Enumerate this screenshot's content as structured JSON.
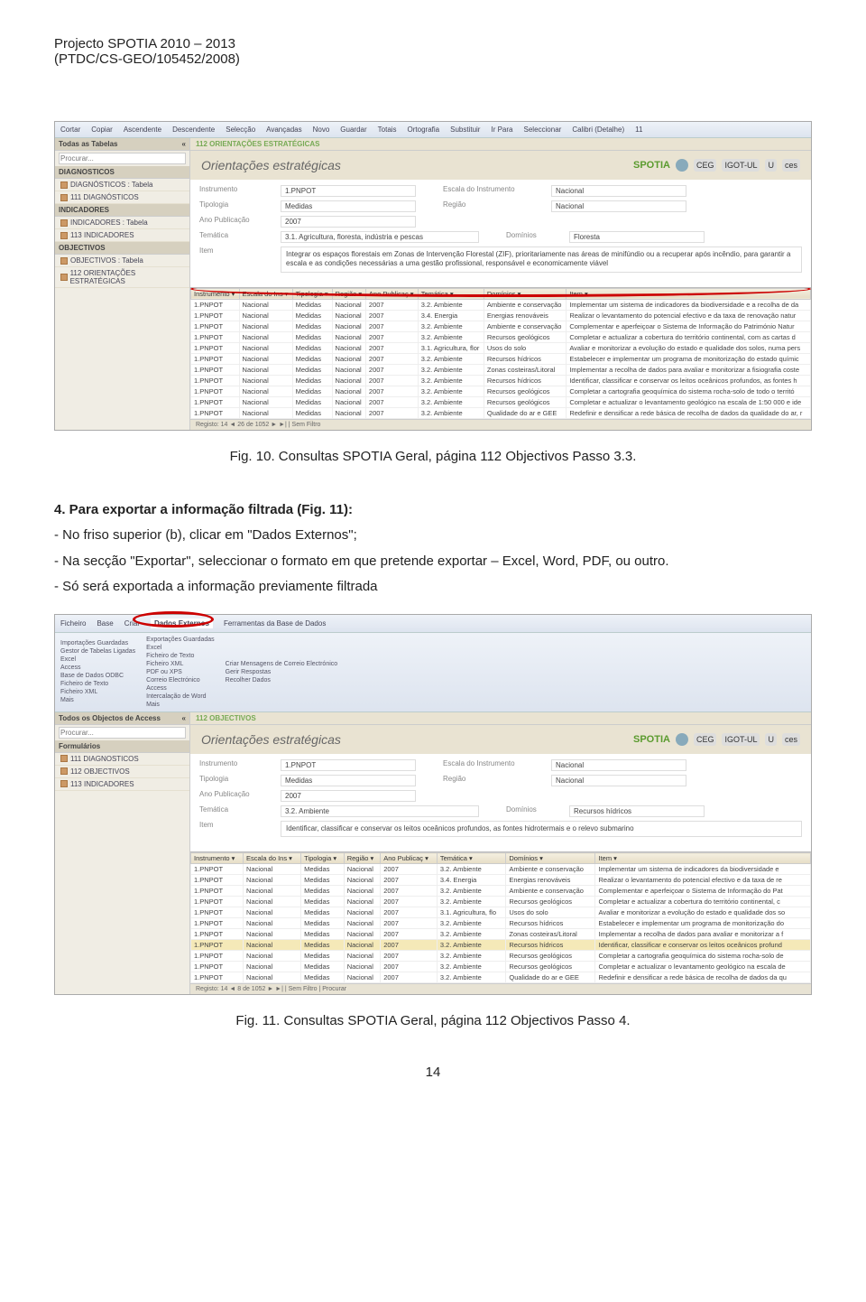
{
  "header": {
    "line1": "Projecto SPOTIA 2010 – 2013",
    "line2": "(PTDC/CS-GEO/105452/2008)"
  },
  "fig10": {
    "caption": "Fig. 10. Consultas SPOTIA Geral, página 112 Objectivos Passo 3.3.",
    "ribbon": [
      "Cortar",
      "Copiar",
      "Ascendente",
      "Descendente",
      "Selecção",
      "Avançadas",
      "Novo",
      "Guardar",
      "Totais",
      "Ortografia",
      "Substituir",
      "Ir Para",
      "Seleccionar",
      "Calibri (Detalhe)",
      "11"
    ],
    "sidebar": {
      "topLabel": "Todas as Tabelas",
      "searchPlaceholder": "Procurar...",
      "groups": [
        {
          "hdr": "DIAGNOSTICOS",
          "items": [
            "DIAGNÓSTICOS : Tabela",
            "111 DIAGNÓSTICOS"
          ]
        },
        {
          "hdr": "INDICADORES",
          "items": [
            "INDICADORES : Tabela",
            "113 INDICADORES"
          ]
        },
        {
          "hdr": "OBJECTIVOS",
          "items": [
            "OBJECTIVOS : Tabela",
            "112 ORIENTAÇÕES ESTRATÉGICAS"
          ]
        }
      ]
    },
    "tabLabel": "112 ORIENTAÇÕES ESTRATÉGICAS",
    "formTitle": "Orientações estratégicas",
    "logos": {
      "brand": "SPOTIA",
      "c1": "CEG",
      "c2": "IGOT-UL",
      "c3": "U",
      "c4": "ces"
    },
    "fields": {
      "instrumento": {
        "lbl": "Instrumento",
        "val": "1.PNPOT"
      },
      "escala": {
        "lbl": "Escala do Instrumento",
        "val": "Nacional"
      },
      "tipologia": {
        "lbl": "Tipologia",
        "val": "Medidas"
      },
      "regiao": {
        "lbl": "Região",
        "val": "Nacional"
      },
      "ano": {
        "lbl": "Ano Publicação",
        "val": "2007"
      },
      "tematica": {
        "lbl": "Temática",
        "val": "3.1. Agricultura, floresta, indústria e pescas"
      },
      "dominios": {
        "lbl": "Domínios",
        "val": "Floresta"
      },
      "item": {
        "lbl": "Item",
        "val": "Integrar os espaços florestais em Zonas de Intervenção Florestal (ZIF), prioritariamente nas áreas de minifúndio ou a recuperar após incêndio, para garantir a escala e as condições necessárias a uma gestão profissional, responsável e economicamente viável"
      }
    },
    "gridHeaders": [
      "Instrumento",
      "Escala do Ins",
      "Tipologia",
      "Região",
      "Ano Publicaç",
      "Temática",
      "Domínios",
      "Item"
    ],
    "gridRows": [
      [
        "1.PNPOT",
        "Nacional",
        "Medidas",
        "Nacional",
        "2007",
        "3.2. Ambiente",
        "Ambiente e conservação",
        "Implementar um sistema de indicadores da biodiversidade e a recolha de da"
      ],
      [
        "1.PNPOT",
        "Nacional",
        "Medidas",
        "Nacional",
        "2007",
        "3.4. Energia",
        "Energias renováveis",
        "Realizar o levantamento do potencial efectivo e da taxa de renovação natur"
      ],
      [
        "1.PNPOT",
        "Nacional",
        "Medidas",
        "Nacional",
        "2007",
        "3.2. Ambiente",
        "Ambiente e conservação",
        "Complementar e aperfeiçoar o Sistema de Informação do Património Natur"
      ],
      [
        "1.PNPOT",
        "Nacional",
        "Medidas",
        "Nacional",
        "2007",
        "3.2. Ambiente",
        "Recursos geológicos",
        "Completar e actualizar a cobertura do território continental, com as cartas d"
      ],
      [
        "1.PNPOT",
        "Nacional",
        "Medidas",
        "Nacional",
        "2007",
        "3.1. Agricultura, flor",
        "Usos do solo",
        "Avaliar e monitorizar a evolução do estado e qualidade dos solos, numa pers"
      ],
      [
        "1.PNPOT",
        "Nacional",
        "Medidas",
        "Nacional",
        "2007",
        "3.2. Ambiente",
        "Recursos hídricos",
        "Estabelecer e implementar um programa de monitorização do estado químic"
      ],
      [
        "1.PNPOT",
        "Nacional",
        "Medidas",
        "Nacional",
        "2007",
        "3.2. Ambiente",
        "Zonas costeiras/Litoral",
        "Implementar a recolha de dados para avaliar e monitorizar a fisiografia coste"
      ],
      [
        "1.PNPOT",
        "Nacional",
        "Medidas",
        "Nacional",
        "2007",
        "3.2. Ambiente",
        "Recursos hídricos",
        "Identificar, classificar e conservar os leitos oceânicos profundos, as fontes h"
      ],
      [
        "1.PNPOT",
        "Nacional",
        "Medidas",
        "Nacional",
        "2007",
        "3.2. Ambiente",
        "Recursos geológicos",
        "Completar a cartografia geoquímica do sistema rocha-solo de todo o territó"
      ],
      [
        "1.PNPOT",
        "Nacional",
        "Medidas",
        "Nacional",
        "2007",
        "3.2. Ambiente",
        "Recursos geológicos",
        "Completar e actualizar o levantamento geológico na escala de 1:50 000 e ide"
      ],
      [
        "1.PNPOT",
        "Nacional",
        "Medidas",
        "Nacional",
        "2007",
        "3.2. Ambiente",
        "Qualidade do ar e GEE",
        "Redefinir e densificar a rede básica de recolha de dados da qualidade do ar, r"
      ]
    ],
    "status": "Registo: 14 ◄ 26 de 1052 ► ►| | Sem Filtro"
  },
  "midText": {
    "p1": "4. Para exportar a informação filtrada (Fig. 11):",
    "p2": "- No friso superior (b), clicar em \"Dados Externos\";",
    "p3": "- Na secção \"Exportar\", seleccionar o formato em que pretende exportar – Excel, Word, PDF, ou outro.",
    "p4": "- Só será exportada a informação previamente filtrada"
  },
  "fig11": {
    "caption": "Fig. 11. Consultas SPOTIA Geral, página 112 Objectivos Passo 4.",
    "ribbonTabs": [
      "Ficheiro",
      "Base",
      "Criar",
      "Dados Externos",
      "Ferramentas da Base de Dados"
    ],
    "ribbonGroups": {
      "import": [
        "Importações Guardadas",
        "Gestor de Tabelas Ligadas",
        "Excel",
        "Access",
        "Base de Dados ODBC",
        "Ficheiro de Texto",
        "Ficheiro XML",
        "Mais"
      ],
      "export": [
        "Exportações Guardadas",
        "Excel",
        "Ficheiro de Texto",
        "Ficheiro XML",
        "PDF ou XPS",
        "Correio Electrónico",
        "Access",
        "Intercalação de Word",
        "Mais"
      ],
      "collect": [
        "Criar Mensagens de Correio Electrónico",
        "Gerir Respostas",
        "Recolher Dados"
      ]
    },
    "sidebar": {
      "topLabel": "Todos os Objectos de Access",
      "searchPlaceholder": "Procurar...",
      "groupHdr": "Formulários",
      "items": [
        "111 DIAGNOSTICOS",
        "112 OBJECTIVOS",
        "113 INDICADORES"
      ]
    },
    "tabLabel": "112 OBJECTIVOS",
    "formTitle": "Orientações estratégicas",
    "fields": {
      "instrumento": {
        "lbl": "Instrumento",
        "val": "1.PNPOT"
      },
      "escala": {
        "lbl": "Escala do Instrumento",
        "val": "Nacional"
      },
      "tipologia": {
        "lbl": "Tipologia",
        "val": "Medidas"
      },
      "regiao": {
        "lbl": "Região",
        "val": "Nacional"
      },
      "ano": {
        "lbl": "Ano Publicação",
        "val": "2007"
      },
      "tematica": {
        "lbl": "Temática",
        "val": "3.2. Ambiente"
      },
      "dominios": {
        "lbl": "Domínios",
        "val": "Recursos hídricos"
      },
      "item": {
        "lbl": "Item",
        "val": "Identificar, classificar e conservar os leitos oceânicos profundos, as fontes hidrotermais e o relevo submarino"
      }
    },
    "gridHeaders": [
      "Instrumento",
      "Escala do Ins",
      "Tipologia",
      "Região",
      "Ano Publicaç",
      "Temática",
      "Domínios",
      "Item"
    ],
    "gridRows": [
      [
        "1.PNPOT",
        "Nacional",
        "Medidas",
        "Nacional",
        "2007",
        "3.2. Ambiente",
        "Ambiente e conservação",
        "Implementar um sistema de indicadores da biodiversidade e"
      ],
      [
        "1.PNPOT",
        "Nacional",
        "Medidas",
        "Nacional",
        "2007",
        "3.4. Energia",
        "Energias renováveis",
        "Realizar o levantamento do potencial efectivo e da taxa de re"
      ],
      [
        "1.PNPOT",
        "Nacional",
        "Medidas",
        "Nacional",
        "2007",
        "3.2. Ambiente",
        "Ambiente e conservação",
        "Complementar e aperfeiçoar o Sistema de Informação do Pat"
      ],
      [
        "1.PNPOT",
        "Nacional",
        "Medidas",
        "Nacional",
        "2007",
        "3.2. Ambiente",
        "Recursos geológicos",
        "Completar e actualizar a cobertura do território continental, c"
      ],
      [
        "1.PNPOT",
        "Nacional",
        "Medidas",
        "Nacional",
        "2007",
        "3.1. Agricultura, flo",
        "Usos do solo",
        "Avaliar e monitorizar a evolução do estado e qualidade dos so"
      ],
      [
        "1.PNPOT",
        "Nacional",
        "Medidas",
        "Nacional",
        "2007",
        "3.2. Ambiente",
        "Recursos hídricos",
        "Estabelecer e implementar um programa de monitorização do"
      ],
      [
        "1.PNPOT",
        "Nacional",
        "Medidas",
        "Nacional",
        "2007",
        "3.2. Ambiente",
        "Zonas costeiras/Litoral",
        "Implementar a recolha de dados para avaliar e monitorizar a f"
      ],
      [
        "1.PNPOT",
        "Nacional",
        "Medidas",
        "Nacional",
        "2007",
        "3.2. Ambiente",
        "Recursos hídricos",
        "Identificar, classificar e conservar os leitos oceânicos profund"
      ],
      [
        "1.PNPOT",
        "Nacional",
        "Medidas",
        "Nacional",
        "2007",
        "3.2. Ambiente",
        "Recursos geológicos",
        "Completar a cartografia geoquímica do sistema rocha-solo de"
      ],
      [
        "1.PNPOT",
        "Nacional",
        "Medidas",
        "Nacional",
        "2007",
        "3.2. Ambiente",
        "Recursos geológicos",
        "Completar e actualizar o levantamento geológico na escala de"
      ],
      [
        "1.PNPOT",
        "Nacional",
        "Medidas",
        "Nacional",
        "2007",
        "3.2. Ambiente",
        "Qualidade do ar e GEE",
        "Redefinir e densificar a rede básica de recolha de dados da qu"
      ]
    ],
    "selRow": 7,
    "status": "Registo: 14 ◄ 8 de 1052 ► ►| | Sem Filtro | Procurar"
  },
  "pageNumber": "14"
}
